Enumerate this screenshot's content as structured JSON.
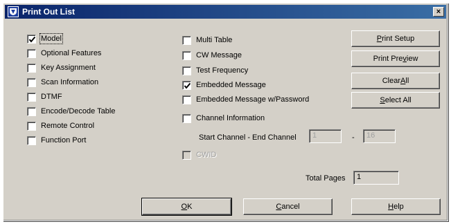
{
  "window": {
    "title": "Print Out List",
    "close_glyph": "×"
  },
  "left_column": [
    {
      "label": "Model",
      "checked": true
    },
    {
      "label": "Optional Features",
      "checked": false
    },
    {
      "label": "Key Assignment",
      "checked": false
    },
    {
      "label": "Scan Information",
      "checked": false
    },
    {
      "label": "DTMF",
      "checked": false
    },
    {
      "label": "Encode/Decode Table",
      "checked": false
    },
    {
      "label": "Remote Control",
      "checked": false
    },
    {
      "label": "Function Port",
      "checked": false
    }
  ],
  "middle_column": [
    {
      "label": "Multi Table",
      "checked": false
    },
    {
      "label": "CW Message",
      "checked": false
    },
    {
      "label": "Test Frequency",
      "checked": false
    },
    {
      "label": "Embedded Message",
      "checked": true
    },
    {
      "label": "Embedded Message w/Password",
      "checked": false
    },
    {
      "label": "Channel Information",
      "checked": false
    }
  ],
  "channel_range": {
    "label": "Start Channel - End Channel",
    "start": "1",
    "separator": "-",
    "end": "16"
  },
  "cwid": {
    "label": "CWID",
    "checked": false,
    "enabled": false
  },
  "total_pages": {
    "label": "Total Pages",
    "value": "1"
  },
  "side_buttons": {
    "print_setup": {
      "pre": "",
      "key": "P",
      "post": "rint Setup"
    },
    "print_preview": {
      "pre": "Print Pre",
      "key": "v",
      "post": "iew"
    },
    "clear_all": {
      "pre": "Clear ",
      "key": "A",
      "post": "ll"
    },
    "select_all": {
      "pre": "",
      "key": "S",
      "post": "elect All"
    }
  },
  "bottom_buttons": {
    "ok": {
      "pre": "",
      "key": "O",
      "post": "K"
    },
    "cancel": {
      "pre": "",
      "key": "C",
      "post": "ancel"
    },
    "help": {
      "pre": "",
      "key": "H",
      "post": "elp"
    }
  }
}
